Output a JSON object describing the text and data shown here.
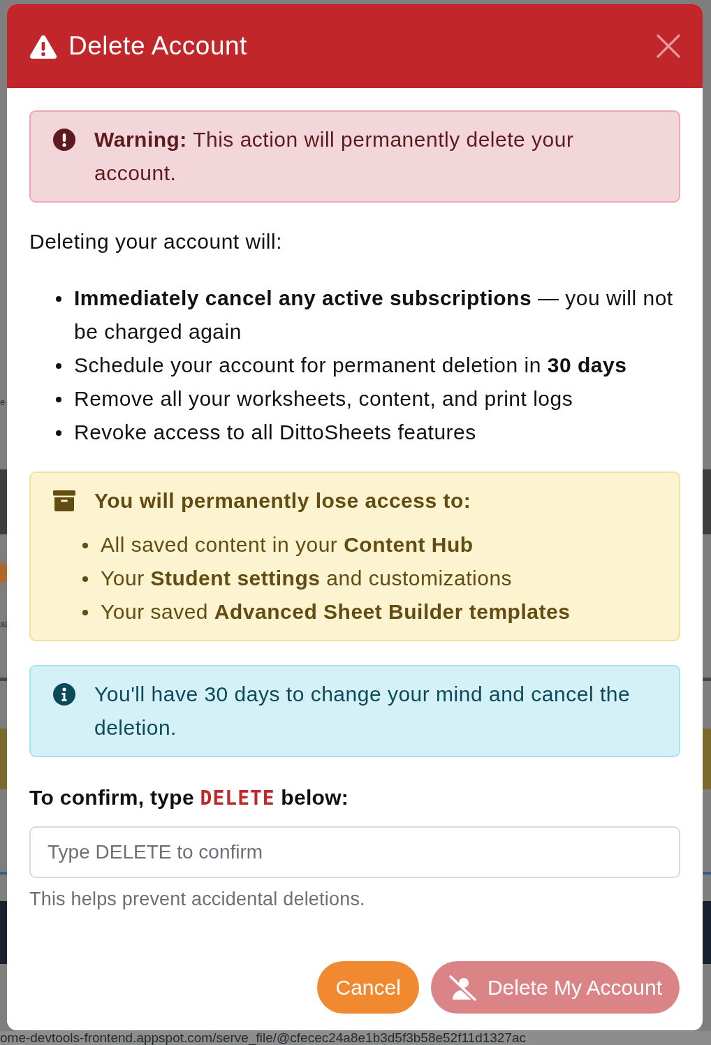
{
  "backdrop": {
    "fragments": [
      {
        "text": "e"
      },
      {
        "text": "ai"
      }
    ],
    "status_url": "ome-devtools-frontend.appspot.com/serve_file/@cfecec24a8e1b3d5f3b58e52f11d1327ac"
  },
  "dialog": {
    "title": "Delete Account",
    "warning": "**Warning:** This action will permanently delete your account.",
    "intro": "Deleting your account will:",
    "consequences": [
      "**Immediately cancel any active subscriptions** — you will not be charged again",
      "Schedule your account for permanent deletion in **30 days**",
      "Remove all your worksheets, content, and print logs",
      "Revoke access to all DittoSheets features"
    ],
    "loss_notice": {
      "heading": "You will permanently lose access to:",
      "items": [
        "All saved content in your **Content Hub**",
        "Your **Student settings** and customizations",
        "Your saved **Advanced Sheet Builder templates**"
      ]
    },
    "info": "You'll have 30 days to change your mind and cancel the deletion.",
    "confirm": {
      "label_before": "To confirm, type",
      "keyword": "DELETE",
      "label_after": "below:",
      "placeholder": "Type DELETE to confirm",
      "help": "This helps prevent accidental deletions."
    },
    "buttons": [
      {
        "kind": "cancel",
        "label": "Cancel",
        "disabled": false
      },
      {
        "kind": "danger",
        "label": "Delete My Account",
        "disabled": true
      }
    ]
  }
}
